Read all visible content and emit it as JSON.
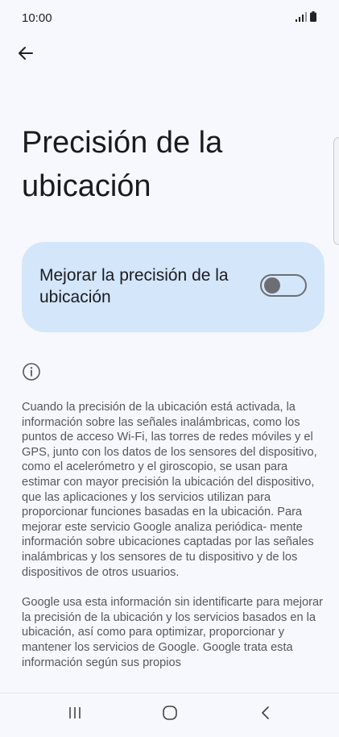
{
  "status_bar": {
    "time": "10:00",
    "signal_icon": "signal-bars-icon",
    "battery_icon": "battery-icon"
  },
  "header": {
    "back_icon": "arrow-left-icon"
  },
  "page": {
    "title": "Precisión de la ubicación"
  },
  "toggle": {
    "label": "Mejorar la precisión de la ubicación",
    "state": "off"
  },
  "info": {
    "icon": "info-icon",
    "paragraphs": [
      "Cuando la precisión de la ubicación está activada, la información sobre las señales inalámbricas, como los puntos de acceso Wi-Fi, las torres de redes móviles y el GPS, junto con los datos de los sensores del dispositivo, como el acelerómetro y el giroscopio, se usan para estimar con mayor precisión la ubicación del dispositivo, que las aplicaciones y los servicios utilizan para proporcionar funciones basadas en la ubicación. Para mejorar este servicio Google analiza periódica- mente información sobre ubicaciones captadas por las señales inalámbricas y los sensores de tu dispositivo y de los dispositivos de otros usuarios.",
      "Google usa esta información sin identificarte para mejorar la precisión de la ubicación y los servicios basados en la ubicación, así como para optimizar, proporcionar y mantener los servicios de Google. Google trata esta información según sus propios"
    ]
  },
  "nav_bar": {
    "recents_icon": "recent-apps-icon",
    "home_icon": "home-icon",
    "back_icon": "back-chevron-icon"
  },
  "colors": {
    "background": "#f7f8fd",
    "card": "#d4e6fa",
    "switch": "#6d6e73"
  }
}
